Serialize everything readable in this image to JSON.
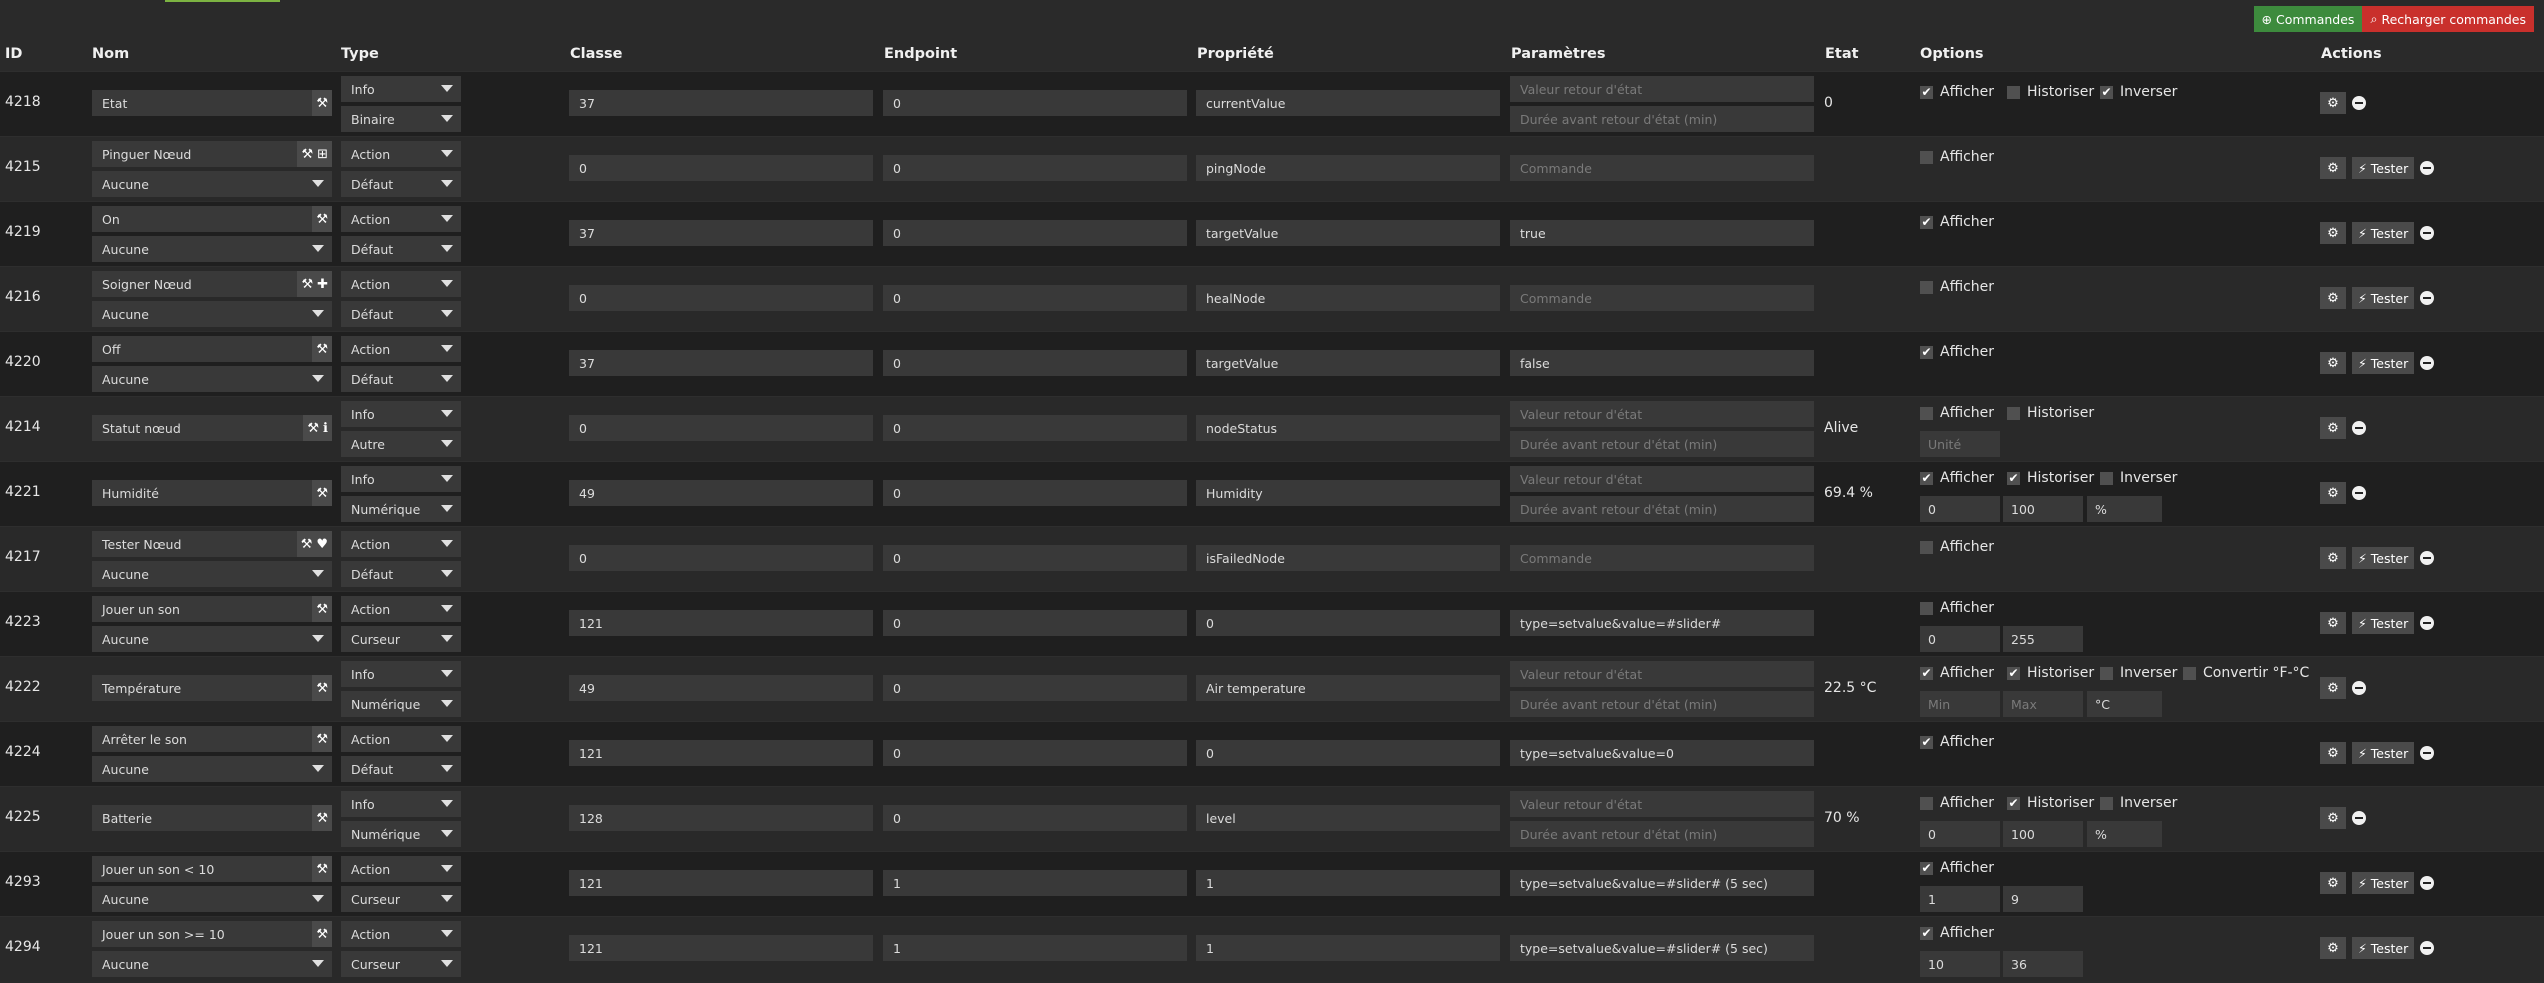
{
  "toolbar": {
    "commands_label": "Commandes",
    "reload_label": "Recharger commandes",
    "plus_icon": "plus-circle-icon",
    "search_icon": "search-icon"
  },
  "headers": {
    "id": "ID",
    "nom": "Nom",
    "type": "Type",
    "classe": "Classe",
    "endpoint": "Endpoint",
    "propriete": "Propriété",
    "parametres": "Paramètres",
    "etat": "Etat",
    "options": "Options",
    "actions": "Actions"
  },
  "labels": {
    "afficher": "Afficher",
    "historiser": "Historiser",
    "inverser": "Inverser",
    "convertir": "Convertir °F-°C",
    "tester": "Tester"
  },
  "placeholders": {
    "valeur_retour": "Valeur retour d'état",
    "duree_retour": "Durée avant retour d'état (min)",
    "commande": "Commande",
    "unite": "Unité",
    "min": "Min",
    "max": "Max"
  },
  "rows": [
    {
      "id": "4218",
      "name": "Etat",
      "sub": "",
      "type": "Info",
      "subtype": "Binaire",
      "classe": "37",
      "endpoint": "0",
      "prop": "currentValue",
      "param": "",
      "etat": "0"
    },
    {
      "id": "4215",
      "name": "Pinguer Nœud",
      "sub": "Aucune",
      "type": "Action",
      "subtype": "Défaut",
      "classe": "0",
      "endpoint": "0",
      "prop": "pingNode",
      "param": "",
      "etat": ""
    },
    {
      "id": "4219",
      "name": "On",
      "sub": "Aucune",
      "type": "Action",
      "subtype": "Défaut",
      "classe": "37",
      "endpoint": "0",
      "prop": "targetValue",
      "param": "true",
      "etat": ""
    },
    {
      "id": "4216",
      "name": "Soigner Nœud",
      "sub": "Aucune",
      "type": "Action",
      "subtype": "Défaut",
      "classe": "0",
      "endpoint": "0",
      "prop": "healNode",
      "param": "",
      "etat": ""
    },
    {
      "id": "4220",
      "name": "Off",
      "sub": "Aucune",
      "type": "Action",
      "subtype": "Défaut",
      "classe": "37",
      "endpoint": "0",
      "prop": "targetValue",
      "param": "false",
      "etat": ""
    },
    {
      "id": "4214",
      "name": "Statut nœud",
      "sub": "",
      "type": "Info",
      "subtype": "Autre",
      "classe": "0",
      "endpoint": "0",
      "prop": "nodeStatus",
      "param": "",
      "etat": "Alive"
    },
    {
      "id": "4221",
      "name": "Humidité",
      "sub": "",
      "type": "Info",
      "subtype": "Numérique",
      "classe": "49",
      "endpoint": "0",
      "prop": "Humidity",
      "param": "",
      "etat": "69.4 %",
      "min": "0",
      "max": "100",
      "unit": "%"
    },
    {
      "id": "4217",
      "name": "Tester Nœud",
      "sub": "Aucune",
      "type": "Action",
      "subtype": "Défaut",
      "classe": "0",
      "endpoint": "0",
      "prop": "isFailedNode",
      "param": "",
      "etat": ""
    },
    {
      "id": "4223",
      "name": "Jouer un son",
      "sub": "Aucune",
      "type": "Action",
      "subtype": "Curseur",
      "classe": "121",
      "endpoint": "0",
      "prop": "0",
      "param": "type=setvalue&value=#slider#",
      "etat": "",
      "min": "0",
      "max": "255"
    },
    {
      "id": "4222",
      "name": "Température",
      "sub": "",
      "type": "Info",
      "subtype": "Numérique",
      "classe": "49",
      "endpoint": "0",
      "prop": "Air temperature",
      "param": "",
      "etat": "22.5 °C",
      "unit": "°C"
    },
    {
      "id": "4224",
      "name": "Arrêter le son",
      "sub": "Aucune",
      "type": "Action",
      "subtype": "Défaut",
      "classe": "121",
      "endpoint": "0",
      "prop": "0",
      "param": "type=setvalue&value=0",
      "etat": ""
    },
    {
      "id": "4225",
      "name": "Batterie",
      "sub": "",
      "type": "Info",
      "subtype": "Numérique",
      "classe": "128",
      "endpoint": "0",
      "prop": "level",
      "param": "",
      "etat": "70 %",
      "min": "0",
      "max": "100",
      "unit": "%"
    },
    {
      "id": "4293",
      "name": "Jouer un son < 10",
      "sub": "Aucune",
      "type": "Action",
      "subtype": "Curseur",
      "classe": "121",
      "endpoint": "1",
      "prop": "1",
      "param": "type=setvalue&value=#slider# (5 sec)",
      "etat": "",
      "min": "1",
      "max": "9"
    },
    {
      "id": "4294",
      "name": "Jouer un son >= 10",
      "sub": "Aucune",
      "type": "Action",
      "subtype": "Curseur",
      "classe": "121",
      "endpoint": "1",
      "prop": "1",
      "param": "type=setvalue&value=#slider# (5 sec)",
      "etat": "",
      "min": "10",
      "max": "36"
    }
  ]
}
